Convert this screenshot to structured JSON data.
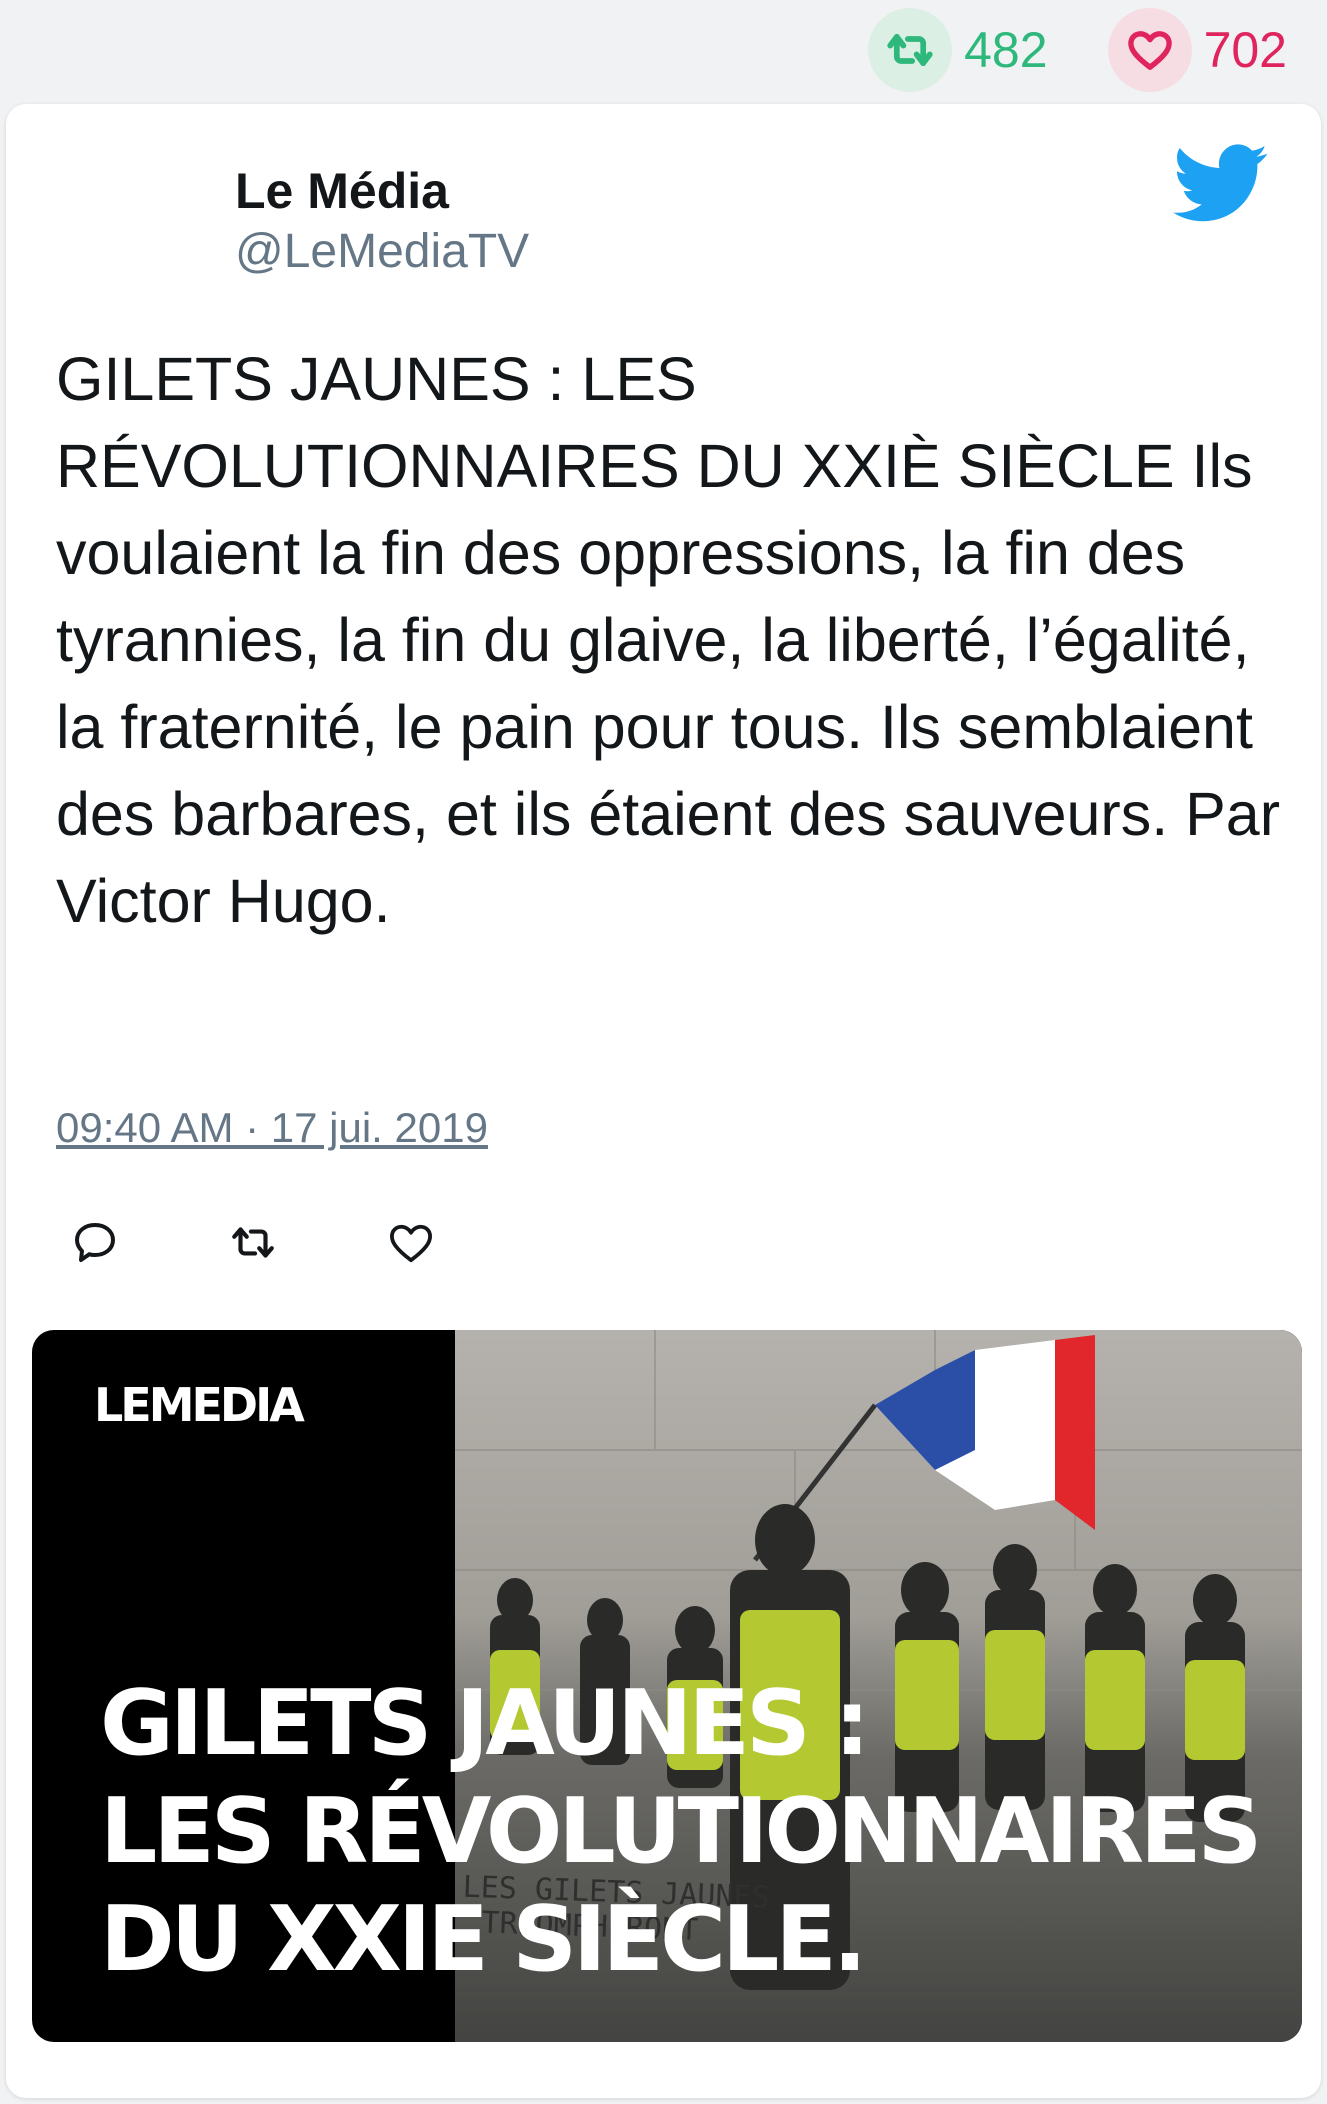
{
  "stats": {
    "retweets": "482",
    "likes": "702",
    "retweet_color": "#2eb87c",
    "like_color": "#e0245e"
  },
  "tweet": {
    "author_name": "Le Média",
    "author_handle": "@LeMediaTV",
    "text": "GILETS JAUNES : LES RÉVOLUTIONNAIRES DU XXIÈ SIÈCLE Ils voulaient la fin des oppressions, la fin des tyrannies, la fin du glaive, la liberté, l’égalité, la fraternité, le pain pour tous. Ils semblaient des barbares, et ils étaient des sauveurs. Par Victor Hugo.",
    "timestamp": "09:40 AM · 17 jui. 2019",
    "actions": [
      "reply-icon",
      "retweet-icon",
      "like-icon"
    ],
    "brand_icon": "twitter-bird-icon",
    "brand_color": "#1da1f2"
  },
  "media": {
    "logo": "LEMEDIA",
    "headline_line1": "GILETS JAUNES :",
    "headline_line2": "LES RÉVOLUTIONNAIRES",
    "headline_line3": "DU XXIE SIÈCLE.",
    "wall_text_line1": "LES GILETS JAUNES",
    "wall_text_line2": "TRIOMPHERONT"
  }
}
